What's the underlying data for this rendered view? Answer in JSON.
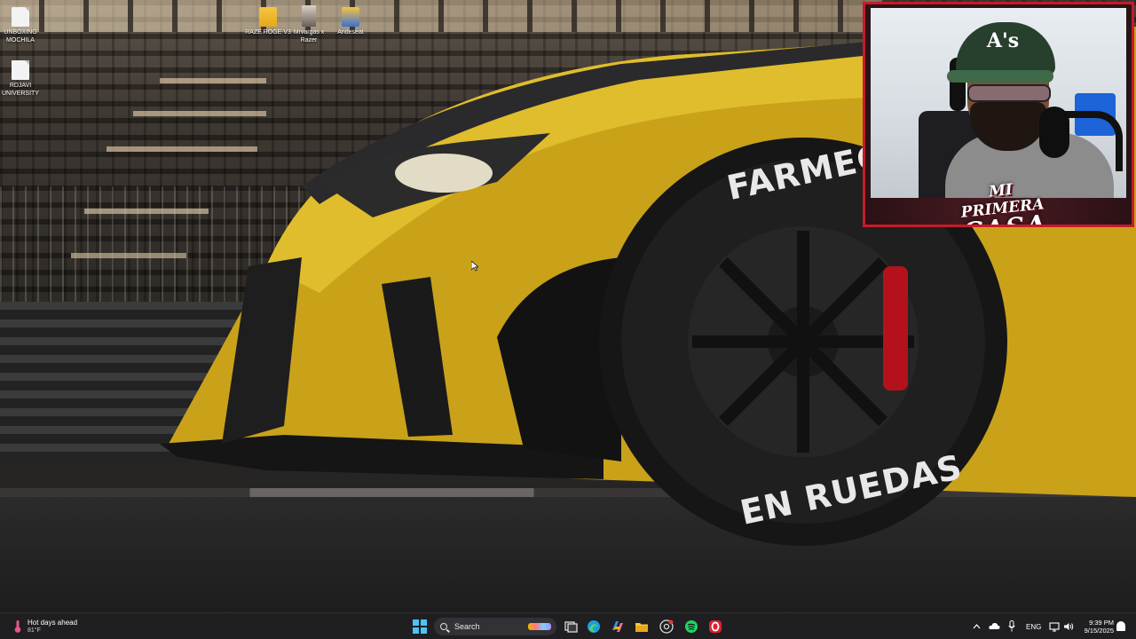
{
  "desktop": {
    "icons": [
      {
        "label": "UNBOXING MOCHILA",
        "icon": "document-icon"
      },
      {
        "label": "RDJAVI UNIVERSITY",
        "icon": "document-icon"
      },
      {
        "label": "RAZE ROGE V3",
        "icon": "folder-icon"
      },
      {
        "label": "Mrvargas x Razer",
        "icon": "image-file-icon"
      },
      {
        "label": "Andeseat",
        "icon": "folder-icon"
      }
    ],
    "wallpaper": {
      "tire_text_top": "FARMEC",
      "tire_text_bottom": "EN RUEDAS"
    }
  },
  "webcam": {
    "cap_logo": "A's",
    "brand_line1": "MI PRIMERA",
    "brand_line2": "CASA"
  },
  "taskbar": {
    "weather": {
      "title": "Hot days ahead",
      "temp": "81°F"
    },
    "search": {
      "placeholder": "Search"
    },
    "apps": [
      "task-view-icon",
      "edge-icon",
      "copilot-icon",
      "file-explorer-icon",
      "chrome-icon",
      "spotify-icon",
      "opera-icon"
    ],
    "tray": {
      "language": "ENG"
    },
    "clock": {
      "time": "9:39 PM",
      "date": "9/15/2025"
    }
  },
  "colors": {
    "accent": "#4cc2ff",
    "webcam_border": "#c51b2b",
    "car_yellow": "#d9b21e",
    "taskbar": "#1f1f21"
  }
}
